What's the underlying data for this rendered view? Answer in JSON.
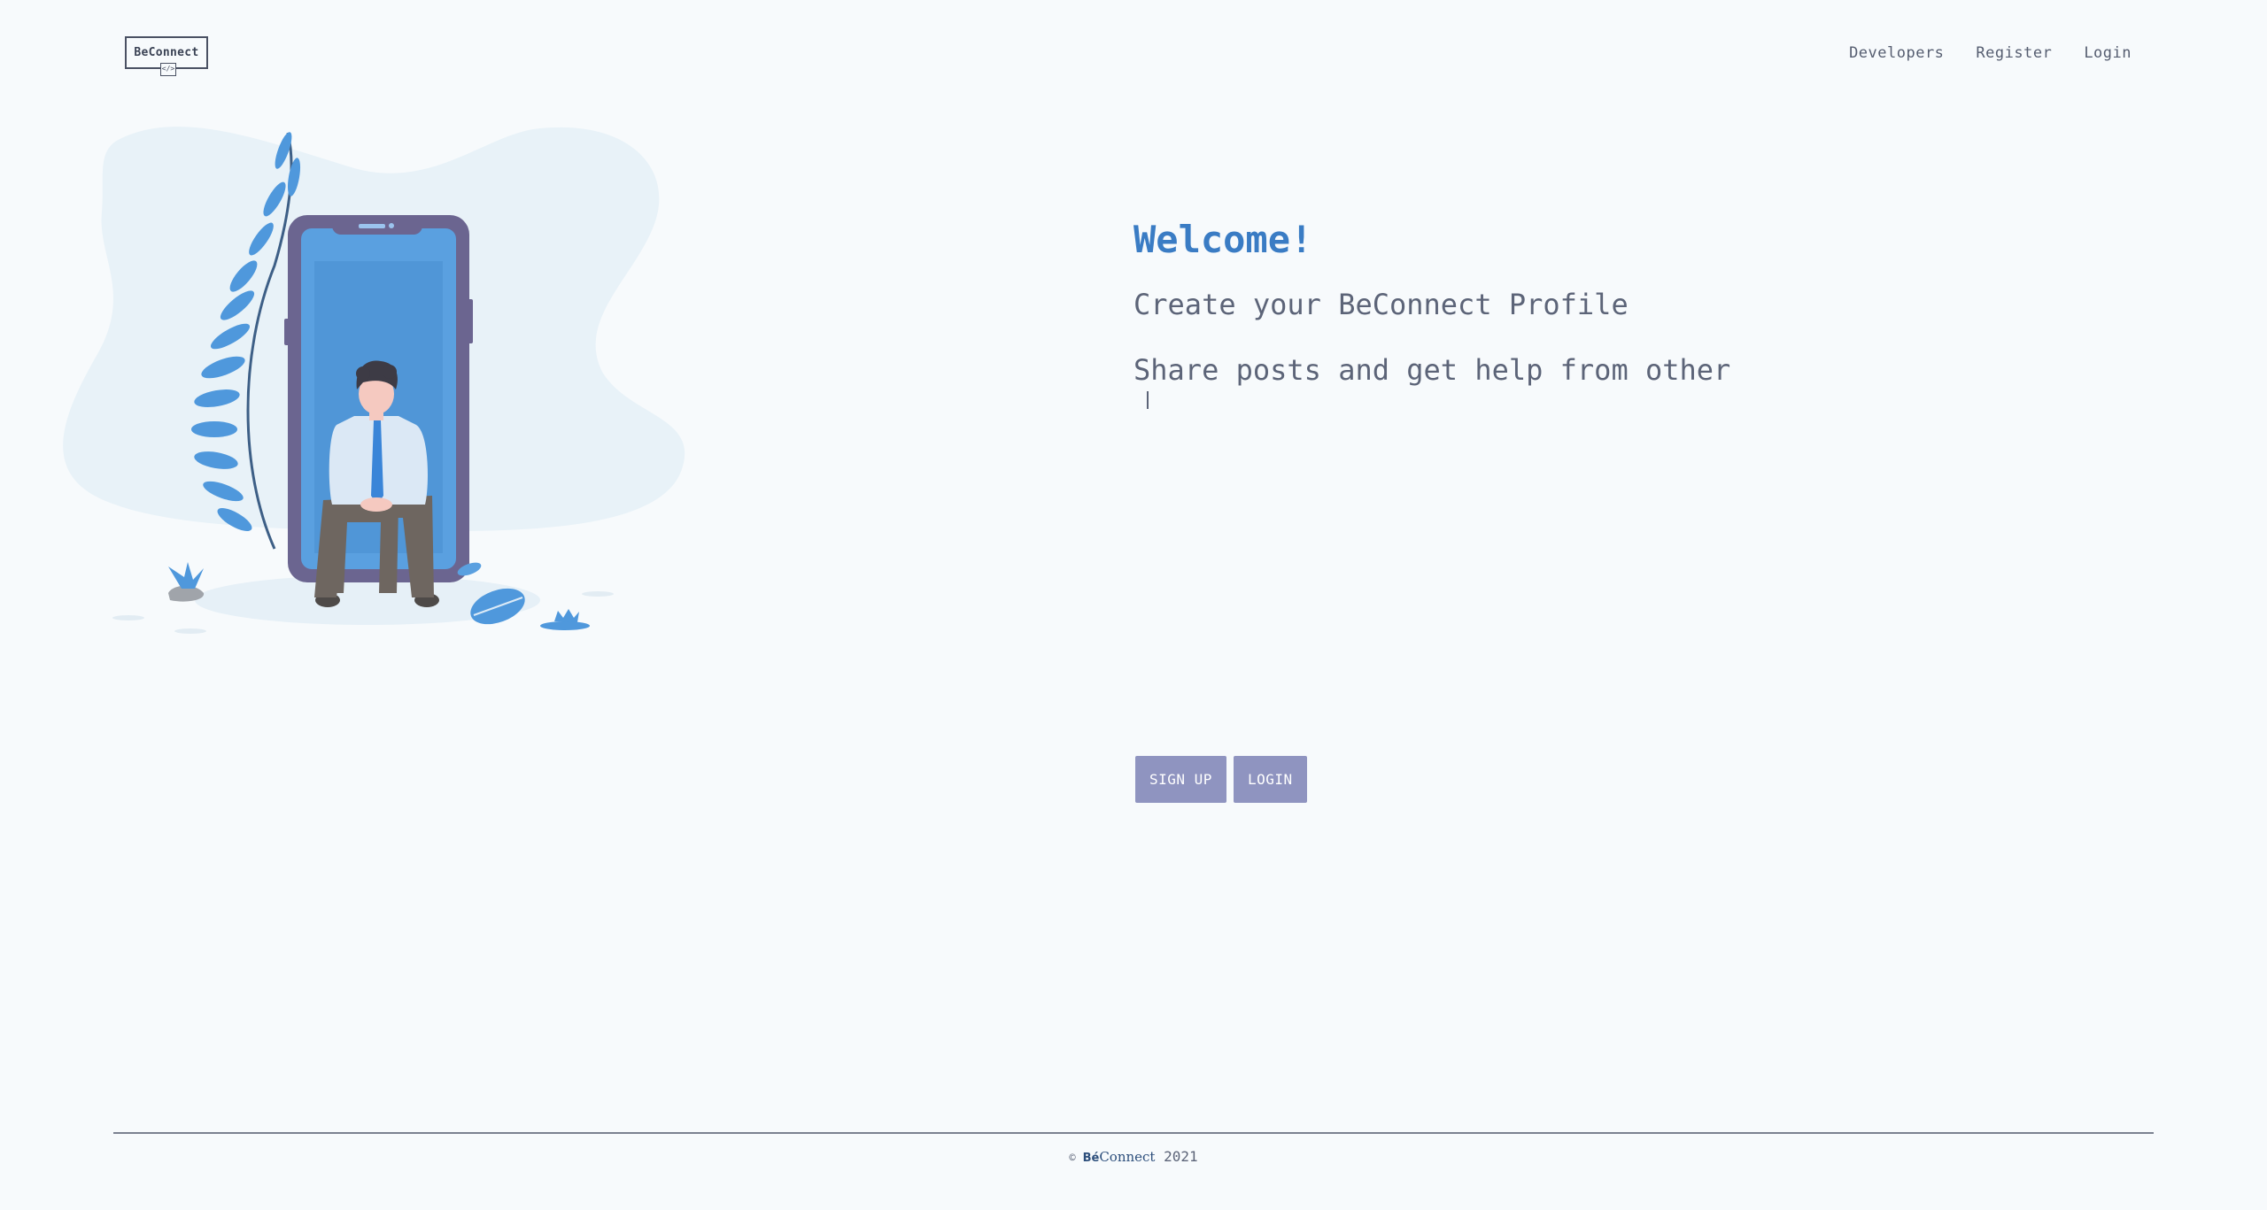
{
  "header": {
    "logo_text": "BeConnect",
    "logo_code_glyph": "</>",
    "nav": [
      "Developers",
      "Register",
      "Login"
    ]
  },
  "hero": {
    "title": "Welcome!",
    "line1": "Create your BeConnect Profile",
    "line2": "Share posts and get help from other"
  },
  "buttons": {
    "signup": "SIGN UP",
    "login": "LOGIN"
  },
  "footer": {
    "copyright_symbol": "©",
    "brand_prefix": "Bé",
    "brand_suffix": "Connect",
    "year": "2021"
  },
  "colors": {
    "background": "#f7fafc",
    "accent_title": "#3a7cc4",
    "button": "#8f94c0",
    "text_muted": "#5c6478",
    "illustration_blue": "#5aa0e0",
    "phone_frame": "#6b6590"
  },
  "illustration": {
    "icon": "person-sitting-in-phone-illustration"
  }
}
